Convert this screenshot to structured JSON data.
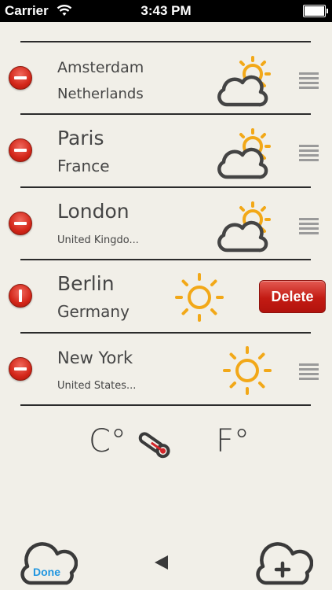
{
  "status_bar": {
    "carrier": "Carrier",
    "time": "3:43 PM"
  },
  "cities": [
    {
      "city": "Amsterdam",
      "country": "Netherlands",
      "weather": "partly-cloudy-icon"
    },
    {
      "city": "Paris",
      "country": "France",
      "weather": "partly-cloudy-icon"
    },
    {
      "city": "London",
      "country": "United Kingdo...",
      "weather": "partly-cloudy-icon"
    },
    {
      "city": "Berlin",
      "country": "Germany",
      "weather": "sun-icon"
    },
    {
      "city": "New York",
      "country": "United States...",
      "weather": "sun-icon"
    }
  ],
  "delete_label": "Delete",
  "units": {
    "celsius": "C°",
    "fahrenheit": "F°"
  },
  "toolbar": {
    "done_label": "Done"
  },
  "colors": {
    "accent": "#2196e0",
    "sun": "#f2a818",
    "delete": "#c31b13"
  }
}
